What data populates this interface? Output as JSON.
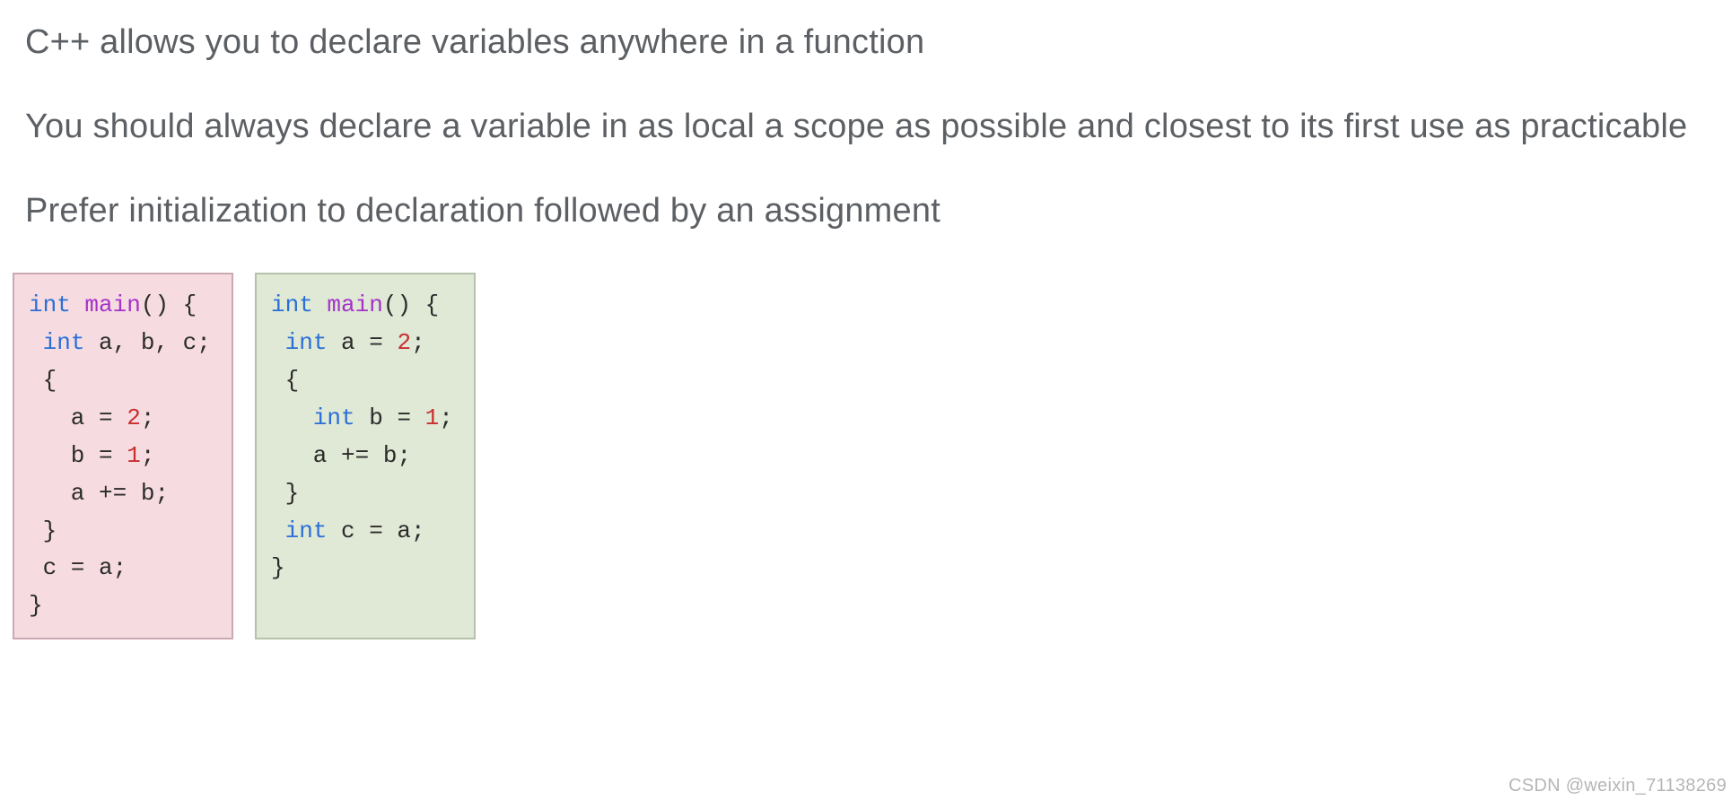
{
  "paragraphs": {
    "p1": "C++ allows you to declare variables anywhere in a function",
    "p2": "You should always declare a variable in as local a scope as possible and closest to its first use as practicable",
    "p3": "Prefer initialization to declaration followed by an assignment"
  },
  "code_bad": {
    "l1_kw": "int",
    "l1_fn": "main",
    "l1_rest": "() {",
    "l2_kw": "int",
    "l2_rest": " a, b, c;",
    "l3": " {",
    "l4_lhs": "   a ",
    "l4_op": "=",
    "l4_sp": " ",
    "l4_num": "2",
    "l4_end": ";",
    "l5_lhs": "   b ",
    "l5_op": "=",
    "l5_sp": " ",
    "l5_num": "1",
    "l5_end": ";",
    "l6_lhs": "   a ",
    "l6_op": "+=",
    "l6_sp": " ",
    "l6_rhs": "b",
    "l6_end": ";",
    "l7": " }",
    "l8": " c = a;",
    "l9": "}"
  },
  "code_good": {
    "l1_kw": "int",
    "l1_fn": "main",
    "l1_rest": "() {",
    "l2_kw": "int",
    "l2_mid": " a ",
    "l2_op": "=",
    "l2_sp": " ",
    "l2_num": "2",
    "l2_end": ";",
    "l3": " {",
    "l4_kw": "int",
    "l4_mid": " b ",
    "l4_op": "=",
    "l4_sp": " ",
    "l4_num": "1",
    "l4_end": ";",
    "l5_lhs": "   a ",
    "l5_op": "+=",
    "l5_sp": " ",
    "l5_rhs": "b",
    "l5_end": ";",
    "l6": " }",
    "l7_kw": "int",
    "l7_mid": " c = a;",
    "l8": "}"
  },
  "watermark": "CSDN @weixin_71138269"
}
